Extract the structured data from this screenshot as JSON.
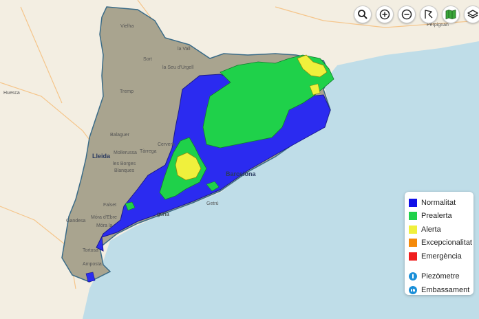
{
  "toolbar": {
    "search": "search-icon",
    "zoom_in": "zoom-in-icon",
    "zoom_out": "zoom-out-icon",
    "draw": "draw-polygon-icon",
    "map": "map-icon",
    "layers": "layers-icon"
  },
  "legend": {
    "items": [
      {
        "label": "Normalitat",
        "color": "#1010e8"
      },
      {
        "label": "Prealerta",
        "color": "#1fd14a"
      },
      {
        "label": "Alerta",
        "color": "#f0f03c"
      },
      {
        "label": "Excepcionalitat",
        "color": "#f58a0a"
      },
      {
        "label": "Emergència",
        "color": "#f01e1e"
      }
    ],
    "layers": [
      {
        "label": "Piezòmetre",
        "icon": "piezometer-icon"
      },
      {
        "label": "Embassament",
        "icon": "reservoir-icon"
      }
    ]
  },
  "map_labels": {
    "lleida": "Lleida",
    "barcelona": "Barcelona",
    "tarragona": "gona",
    "tremp": "Tremp",
    "sort": "Sort",
    "vielha": "Vielha",
    "seu": "la Seu d'Urgell",
    "balaguer": "Balaguer",
    "cervera": "Cervera",
    "tarrega": "Tàrrega",
    "mollerussa": "Mollerussa",
    "borges": "les Borges",
    "blanques": "Blanques",
    "falset": "Falset",
    "gandesa": "Gandesa",
    "mora": "Móra d'Ebre",
    "tortosa": "Tortosa",
    "amposta": "Amposta",
    "huesca": "Huesca",
    "perpignan": "Perpignan",
    "vall": "la Vall",
    "getru": "Getrú",
    "moria": "Móra la"
  }
}
